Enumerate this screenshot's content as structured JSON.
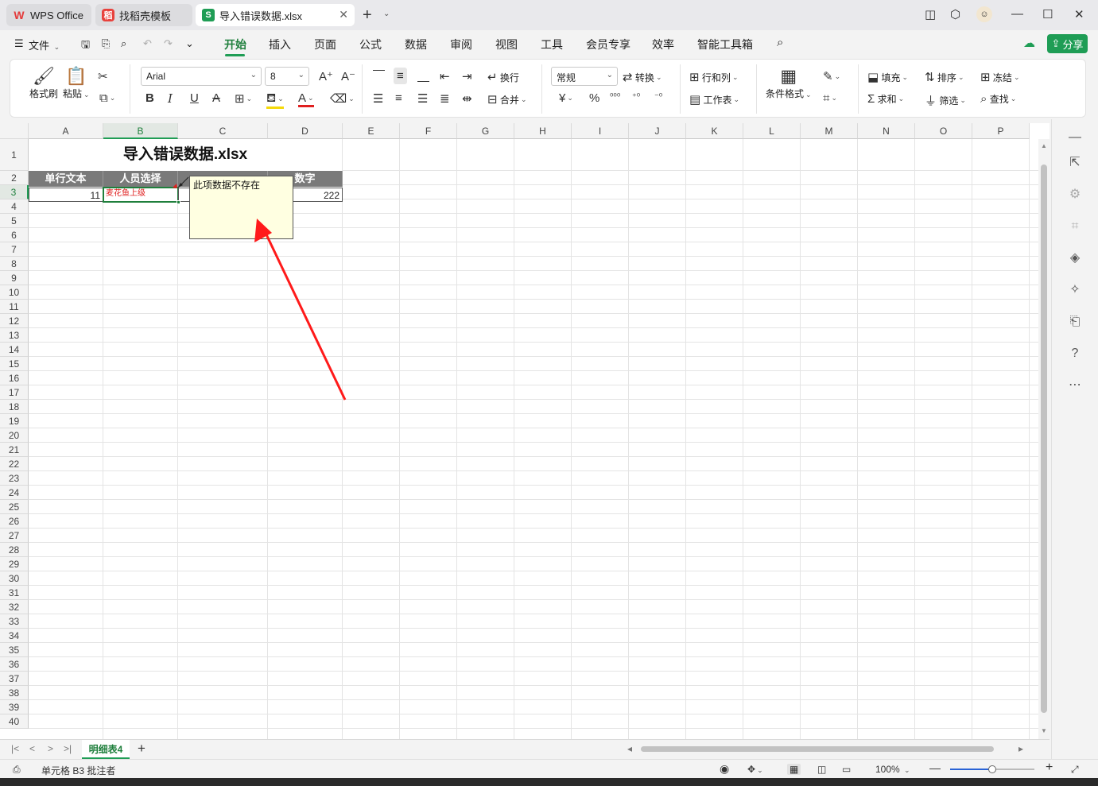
{
  "titlebar": {
    "tabs": [
      {
        "label": "WPS Office",
        "icon": "wps-logo-icon"
      },
      {
        "label": "找稻壳模板",
        "icon": "daoke-logo-icon"
      },
      {
        "label": "导入错误数据.xlsx",
        "icon": "spreadsheet-s-icon"
      }
    ]
  },
  "menubar": {
    "file_label": "文件",
    "tabs": [
      "开始",
      "插入",
      "页面",
      "公式",
      "数据",
      "审阅",
      "视图",
      "工具",
      "会员专享",
      "效率",
      "智能工具箱"
    ],
    "active_tab": "开始",
    "share_label": "分享"
  },
  "ribbon": {
    "format_painter": "格式刷",
    "paste": "粘贴",
    "font_name": "Arial",
    "font_size": "8",
    "wrap": "换行",
    "merge": "合并",
    "number_format": "常规",
    "convert": "转换",
    "row_col": "行和列",
    "worksheet": "工作表",
    "cond_format": "条件格式",
    "fill": "填充",
    "sort": "排序",
    "freeze": "冻结",
    "sum": "求和",
    "filter": "筛选",
    "find": "查找",
    "currency_symbol": "¥",
    "percent_symbol": "%"
  },
  "sheet": {
    "columns": [
      "A",
      "B",
      "C",
      "D",
      "E",
      "F",
      "G",
      "H",
      "I",
      "J",
      "K",
      "L",
      "M",
      "N",
      "O",
      "P"
    ],
    "selected_column": "B",
    "rows": [
      "1",
      "2",
      "3",
      "4",
      "5",
      "6",
      "7",
      "8",
      "9",
      "10",
      "11",
      "12",
      "13",
      "14",
      "15",
      "16",
      "17",
      "18",
      "19",
      "20",
      "21",
      "22",
      "23",
      "24",
      "25",
      "26",
      "27",
      "28",
      "29",
      "30",
      "31",
      "32",
      "33",
      "34",
      "35",
      "36",
      "37",
      "38",
      "39",
      "40"
    ],
    "selected_row": "3",
    "title": "导入错误数据.xlsx",
    "headers": {
      "A": "单行文本",
      "B": "人员选择",
      "D": "数字"
    },
    "data": {
      "A3": "11",
      "B3": "麦花鱼上级",
      "D3": "222"
    },
    "comment": "此项数据不存在",
    "accent_color": "#1f9d55",
    "error_color": "#e02020"
  },
  "sheetbar": {
    "tab_label": "明细表4"
  },
  "statusbar": {
    "cell_info": "单元格 B3 批注者",
    "zoom": "100%",
    "zoom_fraction": 0.5
  }
}
